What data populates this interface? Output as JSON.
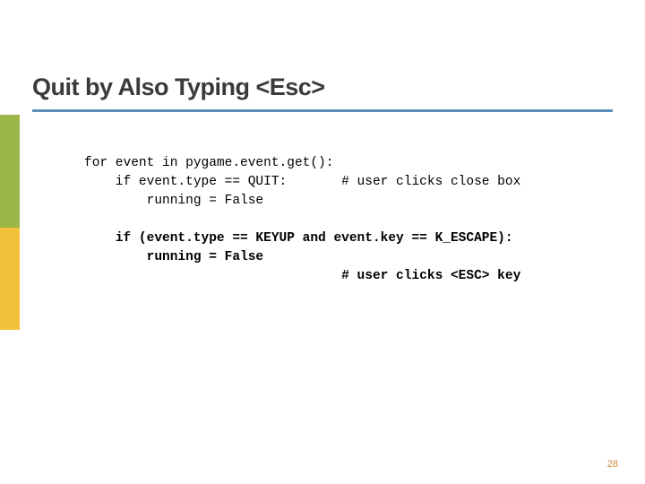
{
  "title": "Quit by Also Typing <Esc>",
  "code": {
    "l1": "for event in pygame.event.get():",
    "l2": "    if event.type == QUIT:       # user clicks close box",
    "l3": "        running = False",
    "l4": "",
    "l5": "    if (event.type == KEYUP and event.key == K_ESCAPE):",
    "l6": "        running = False",
    "l7": "                                 # user clicks <ESC> key"
  },
  "page_number": "28",
  "colors": {
    "underline": "#5b8fb9",
    "green_bar": "#9db64a",
    "yellow_bar": "#f3c23b",
    "page_num": "#d18a3a"
  }
}
